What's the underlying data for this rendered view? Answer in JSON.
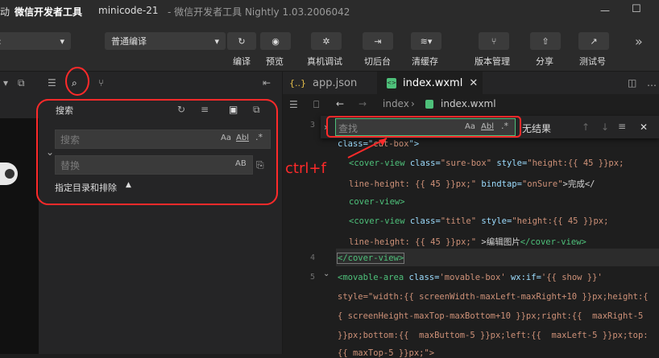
{
  "titlebar": {
    "left_text": "动",
    "app_name": "微信开发者工具",
    "project": "minicode-21",
    "subtitle": "- 微信开发者工具 Nightly 1.03.2006042"
  },
  "toolbar": {
    "mode_select": "普通编译",
    "buttons": [
      {
        "label": "编译",
        "icon": "refresh-icon"
      },
      {
        "label": "预览",
        "icon": "eye-icon"
      },
      {
        "label": "真机调试",
        "icon": "bug-icon"
      },
      {
        "label": "切后台",
        "icon": "switch-icon"
      },
      {
        "label": "清缓存",
        "icon": "layers-icon"
      },
      {
        "label": "版本管理",
        "icon": "branch-icon"
      },
      {
        "label": "分享",
        "icon": "share-icon"
      },
      {
        "label": "测试号",
        "icon": "external-icon"
      }
    ]
  },
  "search_panel": {
    "title": "搜索",
    "search_placeholder": "搜索",
    "replace_placeholder": "替换",
    "case_toggle": "Aa",
    "word_toggle": "Abl",
    "regex_toggle": ".*",
    "preserve_case": "AB",
    "include_label": "指定目录和排除"
  },
  "tabs": [
    {
      "label": "app.json",
      "badge": "{..}"
    },
    {
      "label": "index.wxml",
      "badge": "<>"
    }
  ],
  "breadcrumb": {
    "root": "index",
    "file": "index.wxml"
  },
  "find_widget": {
    "placeholder": "查找",
    "case": "Aa",
    "word": "Abl",
    "regex": ".*",
    "result": "无结果"
  },
  "annotation": "ctrl+f",
  "code": {
    "line3_prefix": "class=\"",
    "line3_val": "cut-box",
    "line3_suffix": "\">",
    "l1_tag": "<cover-view ",
    "l1_a1": "class=",
    "l1_v1": "\"sure-box\"",
    "l1_a2": " style=",
    "l1_v2": "\"height:{{ 45 }}px;",
    "l2_v": "line-height: {{ 45 }}px;\"",
    "l2_a": " bindtap=",
    "l2_v2": "\"onSure\"",
    "l2_t": ">完成</",
    "l3": "cover-view>",
    "l4_tag": "<cover-view ",
    "l4_a1": "class=",
    "l4_v1": "\"title\"",
    "l4_a2": " style=",
    "l4_v2": "\"height:{{ 45 }}px;",
    "l5_v": "line-height: {{ 45 }}px;\"",
    "l5_t": " >编辑图片",
    "l5_tag": "</cover-view>",
    "l6": "</cover-view>",
    "l7_tag": "<movable-area ",
    "l7_a1": "class=",
    "l7_v1": "'movable-box'",
    "l7_a2": " wx:if=",
    "l7_v2": "'{{ show }}'",
    "l8": "style=\"width:{{ screenWidth-maxLeft-maxRight+10 }}px;height:{",
    "l9": "{ screenHeight-maxTop-maxBottom+10 }}px;right:{{  maxRight-5 ",
    "l10": "}}px;bottom:{{  maxButtom-5 }}px;left:{{  maxLeft-5 }}px;top:",
    "l11": "{{ maxTop-5 }}px;\">",
    "line_numbers": [
      "3",
      "4",
      "5"
    ]
  }
}
